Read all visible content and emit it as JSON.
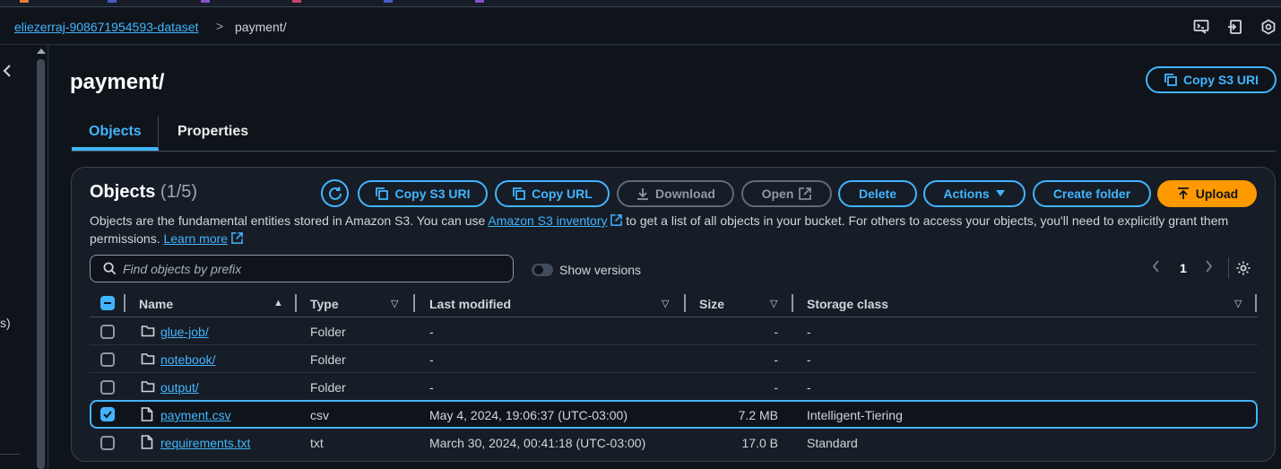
{
  "breadcrumb": {
    "bucket": "eliezerraj-908671954593-dataset",
    "separator": ">",
    "current": "payment/"
  },
  "page": {
    "title": "payment/",
    "copy_uri_label": "Copy S3 URI"
  },
  "tabs": [
    {
      "label": "Objects",
      "active": true
    },
    {
      "label": "Properties",
      "active": false
    }
  ],
  "objects_panel": {
    "title": "Objects",
    "count": "(1/5)",
    "buttons": {
      "copy_s3_uri": "Copy S3 URI",
      "copy_url": "Copy URL",
      "download": "Download",
      "open": "Open",
      "delete": "Delete",
      "actions": "Actions",
      "create_folder": "Create folder",
      "upload": "Upload"
    },
    "description": {
      "part1": "Objects are the fundamental entities stored in Amazon S3. You can use ",
      "link1": "Amazon S3 inventory",
      "part2": " to get a list of all objects in your bucket. For others to access your objects, you'll need to explicitly grant them permissions. ",
      "link2": "Learn more"
    },
    "search": {
      "placeholder": "Find objects by prefix",
      "value": ""
    },
    "show_versions": {
      "label": "Show versions",
      "enabled": false
    },
    "pagination": {
      "page": "1"
    },
    "columns": [
      "Name",
      "Type",
      "Last modified",
      "Size",
      "Storage class"
    ],
    "rows": [
      {
        "name": "glue-job/",
        "icon": "folder-icon",
        "type": "Folder",
        "last_modified": "-",
        "size": "-",
        "storage_class": "-",
        "selected": false
      },
      {
        "name": "notebook/",
        "icon": "folder-icon",
        "type": "Folder",
        "last_modified": "-",
        "size": "-",
        "storage_class": "-",
        "selected": false
      },
      {
        "name": "output/",
        "icon": "folder-icon",
        "type": "Folder",
        "last_modified": "-",
        "size": "-",
        "storage_class": "-",
        "selected": false
      },
      {
        "name": "payment.csv",
        "icon": "file-icon",
        "type": "csv",
        "last_modified": "May 4, 2024, 19:06:37 (UTC-03:00)",
        "size": "7.2 MB",
        "storage_class": "Intelligent-Tiering",
        "selected": true
      },
      {
        "name": "requirements.txt",
        "icon": "file-icon",
        "type": "txt",
        "last_modified": "March 30, 2024, 00:41:18 (UTC-03:00)",
        "size": "17.0 B",
        "storage_class": "Standard",
        "selected": false
      }
    ]
  },
  "left_rail": {
    "fragment": "s)"
  },
  "colors": {
    "accent": "#42b4ff",
    "primary_button": "#ff9900",
    "background": "#0f141a",
    "panel": "#161d26"
  }
}
